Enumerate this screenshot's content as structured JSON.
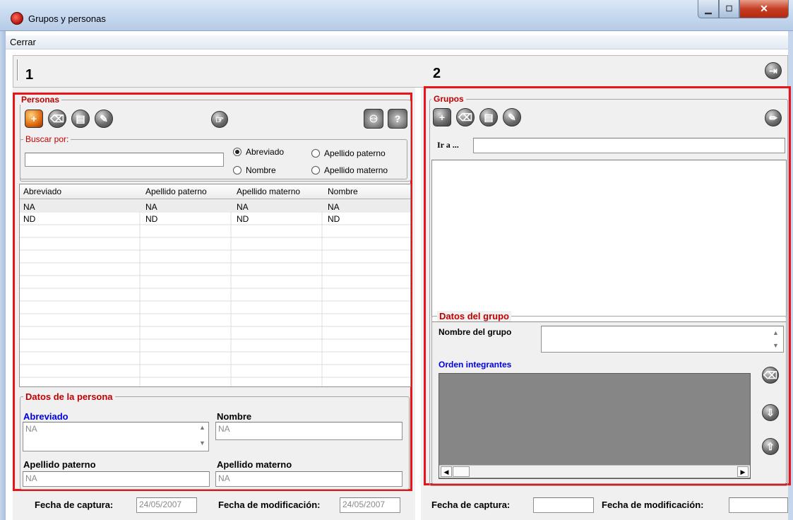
{
  "window": {
    "title": "Grupos y personas"
  },
  "menu": {
    "cerrar": "Cerrar"
  },
  "markers": {
    "one": "1",
    "two": "2"
  },
  "personas": {
    "legend": "Personas",
    "search_legend": "Buscar por:",
    "search_value": "",
    "radios": {
      "abreviado": "Abreviado",
      "nombre": "Nombre",
      "apellido_paterno": "Apellido paterno",
      "apellido_materno": "Apellido materno",
      "selected": "Abreviado"
    },
    "columns": [
      "Abreviado",
      "Apellido paterno",
      "Apellido materno",
      "Nombre"
    ],
    "rows": [
      [
        "NA",
        "NA",
        "NA",
        "NA"
      ],
      [
        "ND",
        "ND",
        "ND",
        "ND"
      ]
    ],
    "datos_legend": "Datos de la persona",
    "abreviado_label": "Abreviado",
    "abreviado_value": "NA",
    "nombre_label": "Nombre",
    "nombre_value": "NA",
    "apellido_paterno_label": "Apellido paterno",
    "apellido_paterno_value": "NA",
    "apellido_materno_label": "Apellido materno",
    "apellido_materno_value": "NA",
    "fecha_captura_label": "Fecha de captura:",
    "fecha_captura_value": "24/05/2007",
    "fecha_mod_label": "Fecha de modificación:",
    "fecha_mod_value": "24/05/2007"
  },
  "grupos": {
    "legend": "Grupos",
    "ir_a_label": "Ir a ...",
    "ir_a_value": "",
    "datos_legend": "Datos del grupo",
    "nombre_grupo_label": "Nombre del grupo",
    "nombre_grupo_value": "",
    "orden_label": "Orden integrantes",
    "fecha_captura_label": "Fecha de captura:",
    "fecha_captura_value": "",
    "fecha_mod_label": "Fecha de modificación:",
    "fecha_mod_value": ""
  },
  "colors": {
    "accent_red": "#e8141a",
    "legend_red": "#c00000",
    "label_blue": "#0000e0"
  },
  "icons": [
    "add-record-icon",
    "eraser-icon",
    "save-icon",
    "edit-icon",
    "pointer-icon",
    "users-icon",
    "users-help-icon",
    "exit-door-icon",
    "pencil-icon",
    "arrow-down-icon",
    "arrow-up-icon"
  ]
}
